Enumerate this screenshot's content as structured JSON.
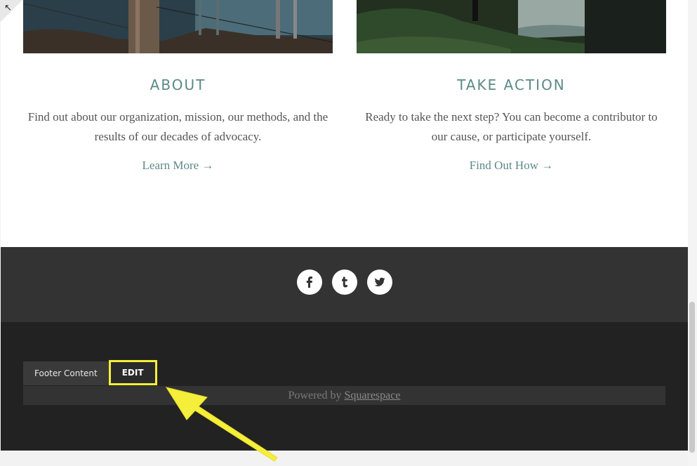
{
  "corner": {
    "glyph": "↖"
  },
  "columns": [
    {
      "title": "ABOUT",
      "text": "Find out about our organization, mission, our methods, and the results of our decades of advocacy.",
      "link": "Learn More →"
    },
    {
      "title": "TAKE ACTION",
      "text": "Ready to take the next step? You can become a contributor to our cause, or participate yourself.",
      "link": "Find Out How →"
    }
  ],
  "social": {
    "icons": [
      "facebook-icon",
      "tumblr-icon",
      "twitter-icon"
    ]
  },
  "footer": {
    "edit_label": "Footer Content",
    "edit_button": "EDIT",
    "powered_prefix": "Powered by",
    "powered_link": "Squarespace"
  },
  "colors": {
    "accent": "#5b8a85",
    "highlight": "#f5ee3a",
    "footer_dark": "#222222",
    "social_band": "#333333"
  }
}
